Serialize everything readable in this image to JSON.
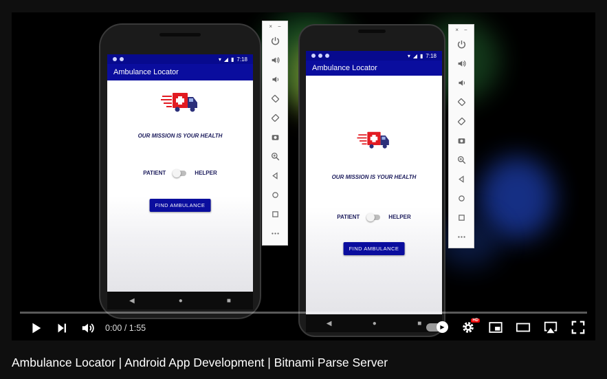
{
  "video": {
    "title": "Ambulance Locator | Android App Development | Bitnami Parse Server",
    "time_current": "0:00",
    "time_separator": " / ",
    "time_total": "1:55",
    "progress_fraction": 0,
    "quality_badge": "HD"
  },
  "phones": [
    {
      "status_time": "7:18",
      "app_title": "Ambulance Locator",
      "mission_text": "OUR MISSION IS YOUR HEALTH",
      "toggle_left_label": "PATIENT",
      "toggle_right_label": "HELPER",
      "button_label": "FIND AMBULANCE"
    },
    {
      "status_time": "7:18",
      "app_title": "Ambulance Locator",
      "mission_text": "OUR MISSION IS YOUR HEALTH",
      "toggle_left_label": "PATIENT",
      "toggle_right_label": "HELPER",
      "button_label": "FIND AMBULANCE"
    }
  ],
  "emulator_panel": {
    "close_glyph": "×",
    "minimize_glyph": "−",
    "controls": [
      "power-icon",
      "volume-up-icon",
      "volume-down-icon",
      "rotate-left-icon",
      "rotate-right-icon",
      "camera-icon",
      "zoom-icon",
      "back-icon",
      "home-icon",
      "overview-icon",
      "more-icon"
    ]
  },
  "colors": {
    "app_primary": "#0a0d9e",
    "youtube_red": "#ff0000",
    "ambulance_red": "#e21b22",
    "ambulance_navy": "#2b2f7a"
  }
}
